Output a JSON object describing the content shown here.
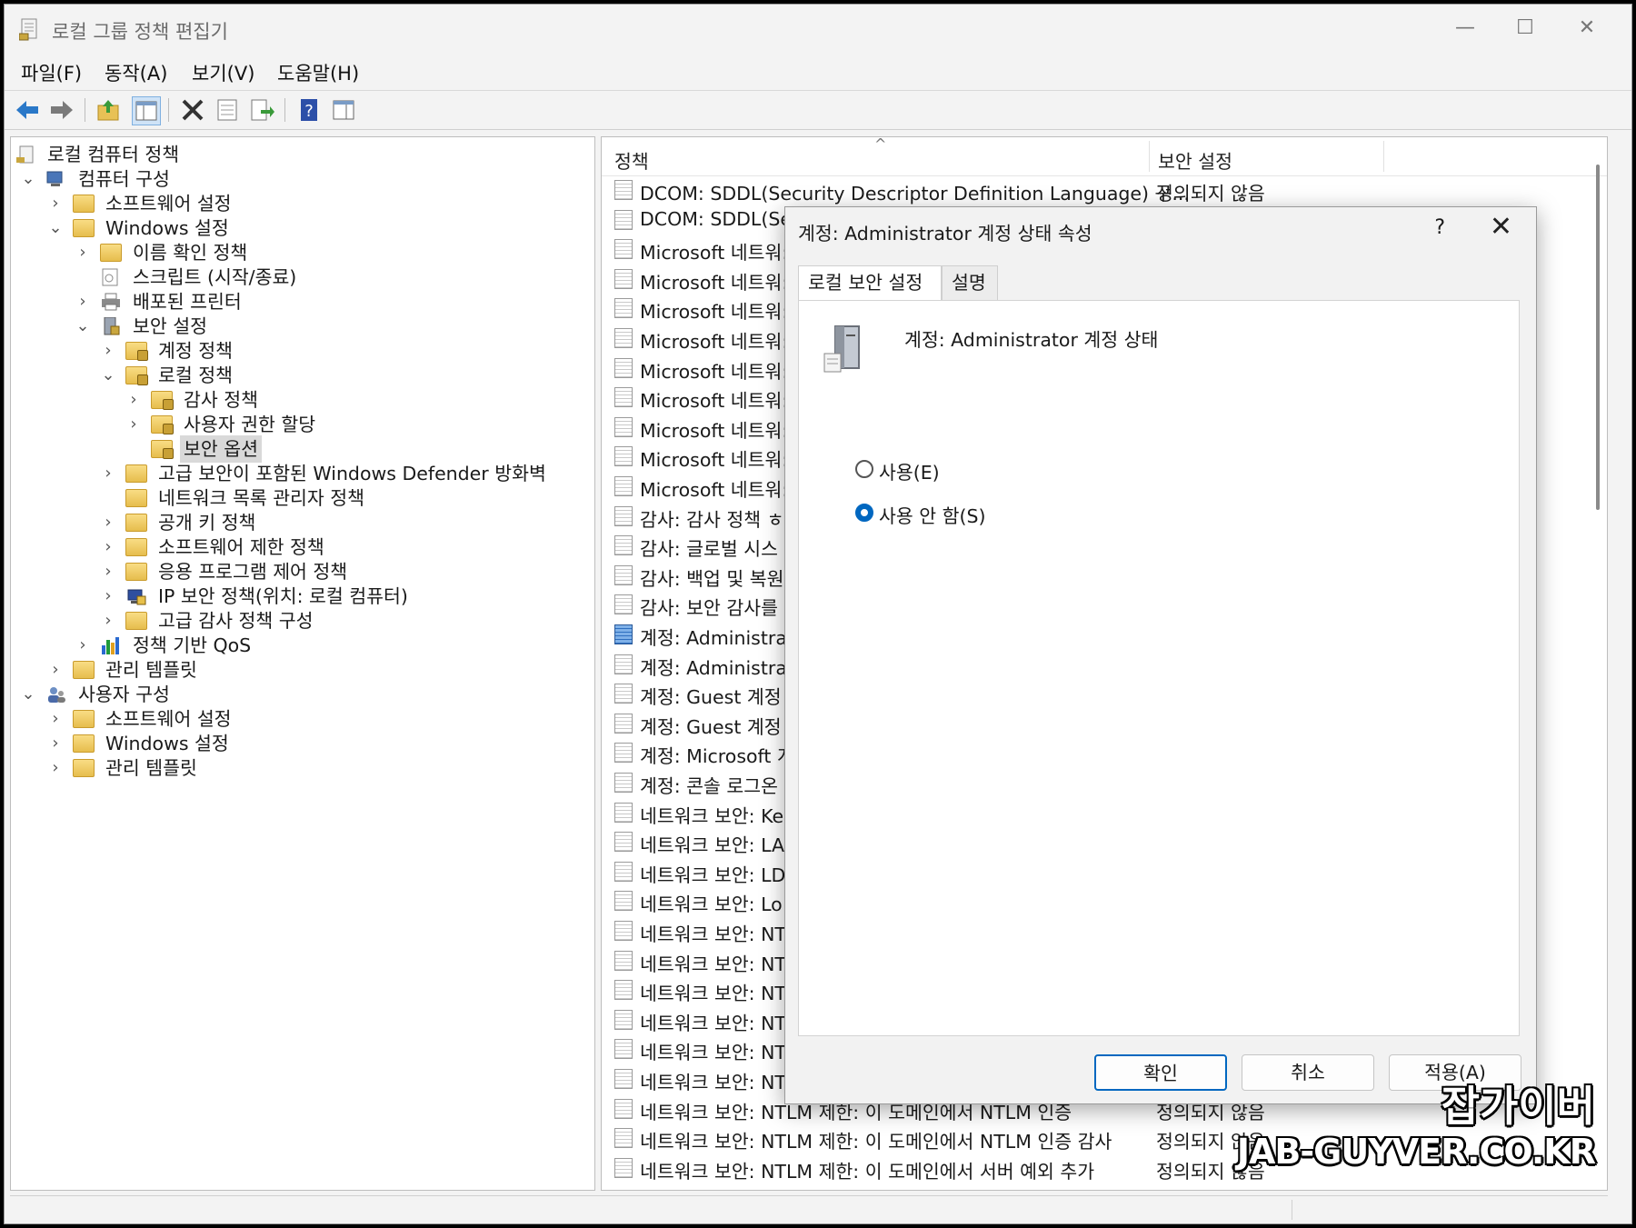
{
  "window": {
    "title": "로컬 그룹 정책 편집기",
    "controls": {
      "minimize": "—",
      "maximize": "☐",
      "close": "✕"
    }
  },
  "menu": [
    "파일(F)",
    "동작(A)",
    "보기(V)",
    "도움말(H)"
  ],
  "toolbar_icons": [
    "back-icon",
    "forward-icon",
    "up-folder-icon",
    "show-hide-tree-icon",
    "delete-icon",
    "properties-icon",
    "export-list-icon",
    "help-icon",
    "action-pane-icon"
  ],
  "tree": {
    "root": "로컬 컴퓨터 정책",
    "computer_config": "컴퓨터 구성",
    "cc_software": "소프트웨어 설정",
    "cc_windows": "Windows 설정",
    "name_resolution": "이름 확인 정책",
    "scripts": "스크립트 (시작/종료)",
    "printers": "배포된 프린터",
    "security_settings": "보안 설정",
    "account_policy": "계정 정책",
    "local_policy": "로컬 정책",
    "audit_policy": "감사 정책",
    "user_rights": "사용자 권한 할당",
    "security_options": "보안 옵션",
    "defender_firewall": "고급 보안이 포함된 Windows Defender 방화벽",
    "network_list": "네트워크 목록 관리자 정책",
    "public_key": "공개 키 정책",
    "software_restriction": "소프트웨어 제한 정책",
    "app_control": "응용 프로그램 제어 정책",
    "ip_security": "IP 보안 정책(위치: 로컬 컴퓨터)",
    "advanced_audit": "고급 감사 정책 구성",
    "qos": "정책 기반 QoS",
    "cc_admin_templates": "관리 템플릿",
    "user_config": "사용자 구성",
    "uc_software": "소프트웨어 설정",
    "uc_windows": "Windows 설정",
    "uc_admin_templates": "관리 템플릿"
  },
  "list": {
    "col_policy": "정책",
    "col_setting": "보안 설정",
    "rows": [
      {
        "name": "DCOM: SDDL(Security Descriptor Definition Language) 구...",
        "setting": "정의되지 않음"
      },
      {
        "name": "DCOM: SDDL(Se",
        "setting": ""
      },
      {
        "name": "Microsoft 네트워:",
        "setting": ""
      },
      {
        "name": "Microsoft 네트워:",
        "setting": ""
      },
      {
        "name": "Microsoft 네트워:",
        "setting": ""
      },
      {
        "name": "Microsoft 네트워:",
        "setting": ""
      },
      {
        "name": "Microsoft 네트워:",
        "setting": ""
      },
      {
        "name": "Microsoft 네트워:",
        "setting": ""
      },
      {
        "name": "Microsoft 네트워:",
        "setting": ""
      },
      {
        "name": "Microsoft 네트워:",
        "setting": ""
      },
      {
        "name": "Microsoft 네트워:",
        "setting": ""
      },
      {
        "name": "감사: 감사 정책 ㅎ",
        "setting": ""
      },
      {
        "name": "감사: 글로벌 시스",
        "setting": ""
      },
      {
        "name": "감사: 백업 및 복원",
        "setting": ""
      },
      {
        "name": "감사: 보안 감사를",
        "setting": ""
      },
      {
        "name": "계정: Administrat",
        "setting": "",
        "active": true
      },
      {
        "name": "계정: Administrat",
        "setting": ""
      },
      {
        "name": "계정: Guest 계정",
        "setting": ""
      },
      {
        "name": "계정: Guest 계정",
        "setting": ""
      },
      {
        "name": "계정: Microsoft 계",
        "setting": ""
      },
      {
        "name": "계정: 콘솔 로그온",
        "setting": ""
      },
      {
        "name": "네트워크 보안: Ke",
        "setting": ""
      },
      {
        "name": "네트워크 보안: LA",
        "setting": ""
      },
      {
        "name": "네트워크 보안: LD",
        "setting": ""
      },
      {
        "name": "네트워크 보안: Lo",
        "setting": ""
      },
      {
        "name": "네트워크 보안: NT",
        "setting": ""
      },
      {
        "name": "네트워크 보안: NT",
        "setting": ""
      },
      {
        "name": "네트워크 보안: NT",
        "setting": ""
      },
      {
        "name": "네트워크 보안: NT",
        "setting": ""
      },
      {
        "name": "네트워크 보안: NT",
        "setting": ""
      },
      {
        "name": "네트워크 보안: NT",
        "setting": ""
      },
      {
        "name": "네트워크 보안: NTLM 제한: 이 도메인에서 NTLM 인증",
        "setting": "정의되지 않음"
      },
      {
        "name": "네트워크 보안: NTLM 제한: 이 도메인에서 NTLM 인증 감사",
        "setting": "정의되지 않음"
      },
      {
        "name": "네트워크 보안: NTLM 제한: 이 도메인에서 서버 예외 추가",
        "setting": "정의되지 않음"
      }
    ]
  },
  "dialog": {
    "title": "계정: Administrator 계정 상태 속성",
    "help": "?",
    "close": "✕",
    "tab_local": "로컬 보안 설정",
    "tab_explain": "설명",
    "policy_name": "계정: Administrator 계정 상태",
    "radio_enabled": "사용(E)",
    "radio_disabled": "사용 안 함(S)",
    "selected": "disabled",
    "ok": "확인",
    "cancel": "취소",
    "apply": "적용(A)"
  },
  "watermark": {
    "line1": "잡가이버",
    "line2": "JAB-GUYVER.CO.KR"
  }
}
